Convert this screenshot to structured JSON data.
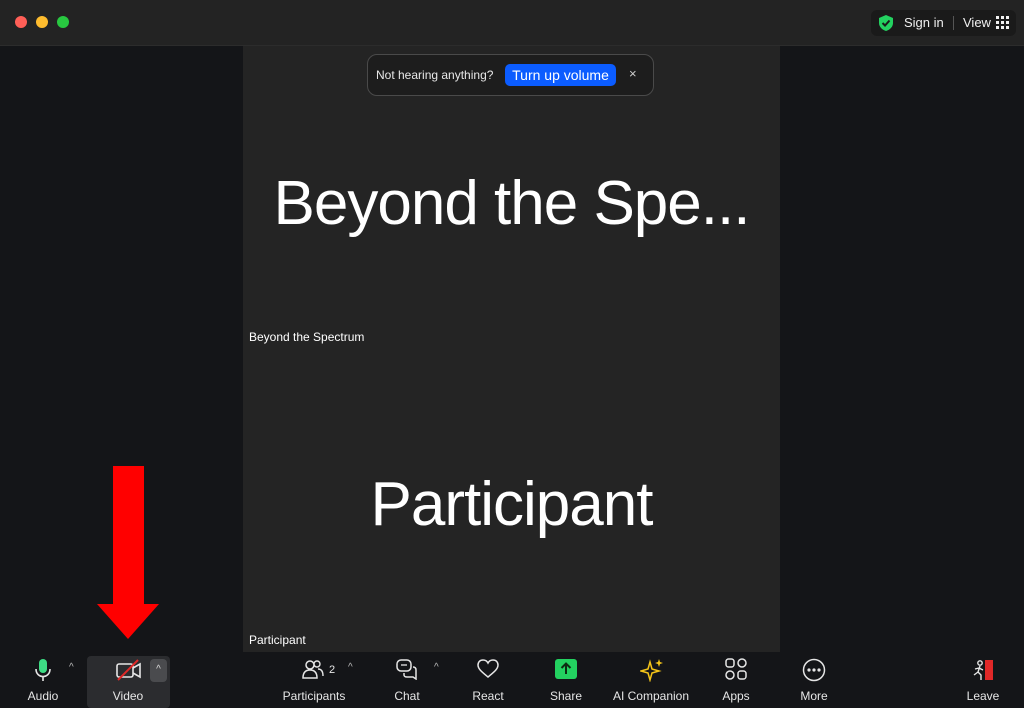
{
  "titlebar": {
    "sign_in": "Sign in",
    "view": "View"
  },
  "toast": {
    "message": "Not hearing anything?",
    "button": "Turn up volume",
    "close": "×"
  },
  "tiles": [
    {
      "display_name": "Beyond the Spe...",
      "name_tag": "Beyond the Spectrum"
    },
    {
      "display_name": "Participant",
      "name_tag": "Participant"
    }
  ],
  "toolbar": {
    "audio": "Audio",
    "video": "Video",
    "participants": "Participants",
    "participants_count": "2",
    "chat": "Chat",
    "react": "React",
    "share": "Share",
    "ai_companion": "AI Companion",
    "apps": "Apps",
    "more": "More",
    "leave": "Leave",
    "caret": "^"
  },
  "colors": {
    "accent_blue": "#0b5cff",
    "share_green": "#23d160",
    "ai_gold": "#f5c518",
    "leave_red": "#e02828",
    "annotation_arrow": "#ff0000",
    "mic_green": "#3ddc84"
  },
  "icons": {
    "security": "shield-check-icon",
    "view": "grid-icon",
    "audio": "microphone-icon",
    "video": "video-off-icon",
    "participants": "people-icon",
    "chat": "chat-bubbles-icon",
    "react": "heart-icon",
    "share": "share-screen-icon",
    "ai_companion": "sparkle-icon",
    "apps": "apps-icon",
    "more": "more-dots-icon",
    "leave": "leave-door-icon"
  }
}
